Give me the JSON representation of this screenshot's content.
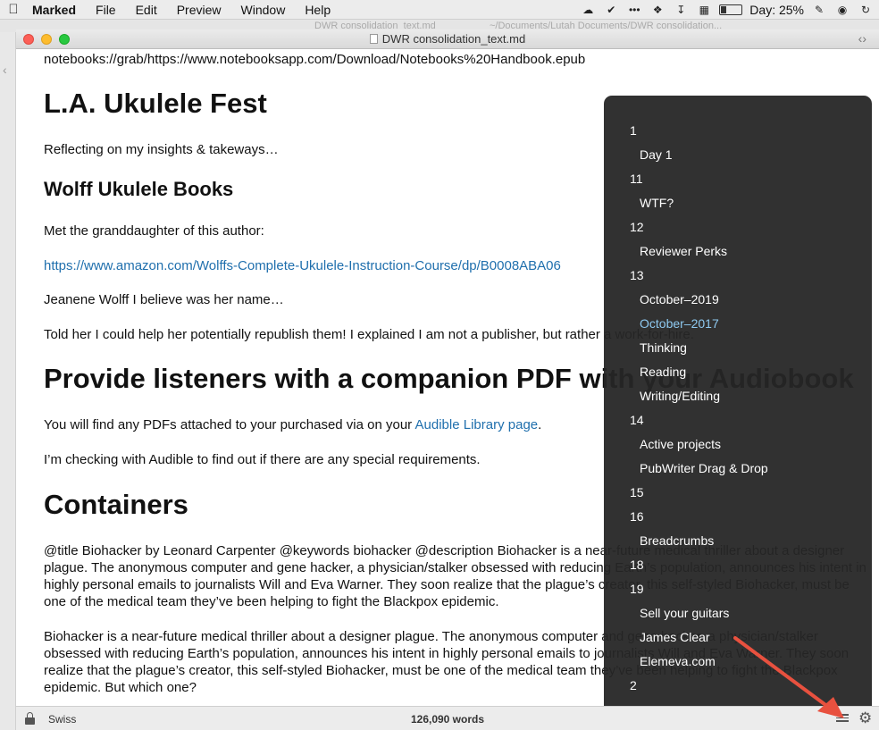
{
  "menubar": {
    "app_name": "Marked",
    "menus": [
      "File",
      "Edit",
      "Preview",
      "Window",
      "Help"
    ],
    "day_status": "Day: 25%"
  },
  "background_window": {
    "title_fragment": "DWR consolidation_text.md",
    "path_fragment": "~/Documents/Lutah Documents/DWR consolidation..."
  },
  "window": {
    "title": "DWR consolidation_text.md"
  },
  "document": {
    "top_line": "notebooks://grab/https://www.notebooksapp.com/Download/Notebooks%20Handbook.epub",
    "h1_ukulele": "L.A. Ukulele Fest",
    "p_reflecting": "Reflecting on my insights & takeways…",
    "h2_wolff": "Wolff Ukulele Books",
    "p_met": "Met the granddaughter of this author:",
    "link_amazon": "https://www.amazon.com/Wolffs-Complete-Ukulele-Instruction-Course/dp/B0008ABA06",
    "p_jeanene": "Jeanene Wolff I believe was her name…",
    "p_told": "Told her I could help her potentially republish them! I explained I am not a publisher, but rather a work-for-hire.",
    "h1_provide": "Provide listeners with a companion PDF with your Audiobook",
    "p_find_prefix": "You will find any PDFs attached to your purchased via on your ",
    "link_audible": "Audible Library page",
    "p_find_suffix": ".",
    "p_checking": "I’m checking with Audible to find out if there are any special requirements.",
    "h1_containers": "Containers",
    "p_biohacker_meta": "@title Biohacker by Leonard Carpenter @keywords biohacker @description Biohacker is a near-future medical thriller about a designer plague. The anonymous computer and gene hacker, a physician/stalker obsessed with reducing Earth’s population, announces his intent in highly personal emails to journalists Will and Eva Warner. They soon realize that the plague’s creator, this self-styled Biohacker, must be one of the medical team they’ve been helping to fight the Blackpox epidemic.",
    "p_biohacker": "Biohacker is a near-future medical thriller about a designer plague. The anonymous computer and gene hacker, a physician/stalker obsessed with reducing Earth’s population, announces his intent in highly personal emails to journalists Will and Eva Warner. They soon realize that the plague’s creator, this self-styled Biohacker, must be one of the medical team they’ve been helping to fight the Blackpox epidemic. But which one?"
  },
  "toc": {
    "items": [
      {
        "label": "1",
        "level": 1
      },
      {
        "label": "Day 1",
        "level": 2
      },
      {
        "label": "11",
        "level": 1
      },
      {
        "label": "WTF?",
        "level": 2
      },
      {
        "label": "12",
        "level": 1
      },
      {
        "label": "Reviewer Perks",
        "level": 2
      },
      {
        "label": "13",
        "level": 1
      },
      {
        "label": "October–2019",
        "level": 2
      },
      {
        "label": "October–2017",
        "level": 2,
        "active": true
      },
      {
        "label": "Thinking",
        "level": 2
      },
      {
        "label": "Reading",
        "level": 2
      },
      {
        "label": "Writing/Editing",
        "level": 2
      },
      {
        "label": "14",
        "level": 1
      },
      {
        "label": "Active projects",
        "level": 2
      },
      {
        "label": "PubWriter Drag & Drop",
        "level": 2
      },
      {
        "label": "15",
        "level": 1
      },
      {
        "label": "16",
        "level": 1
      },
      {
        "label": "Breadcrumbs",
        "level": 2
      },
      {
        "label": "18",
        "level": 1
      },
      {
        "label": "19",
        "level": 1
      },
      {
        "label": "Sell your guitars",
        "level": 2
      },
      {
        "label": "James Clear",
        "level": 2
      },
      {
        "label": "Elemeva.com",
        "level": 2
      },
      {
        "label": "2",
        "level": 1
      }
    ]
  },
  "statusbar": {
    "style": "Swiss",
    "word_count": "126,090 words"
  },
  "colors": {
    "link": "#1f6fad",
    "toc_active": "#8ec9f0",
    "annotation_arrow": "#e8513f"
  }
}
